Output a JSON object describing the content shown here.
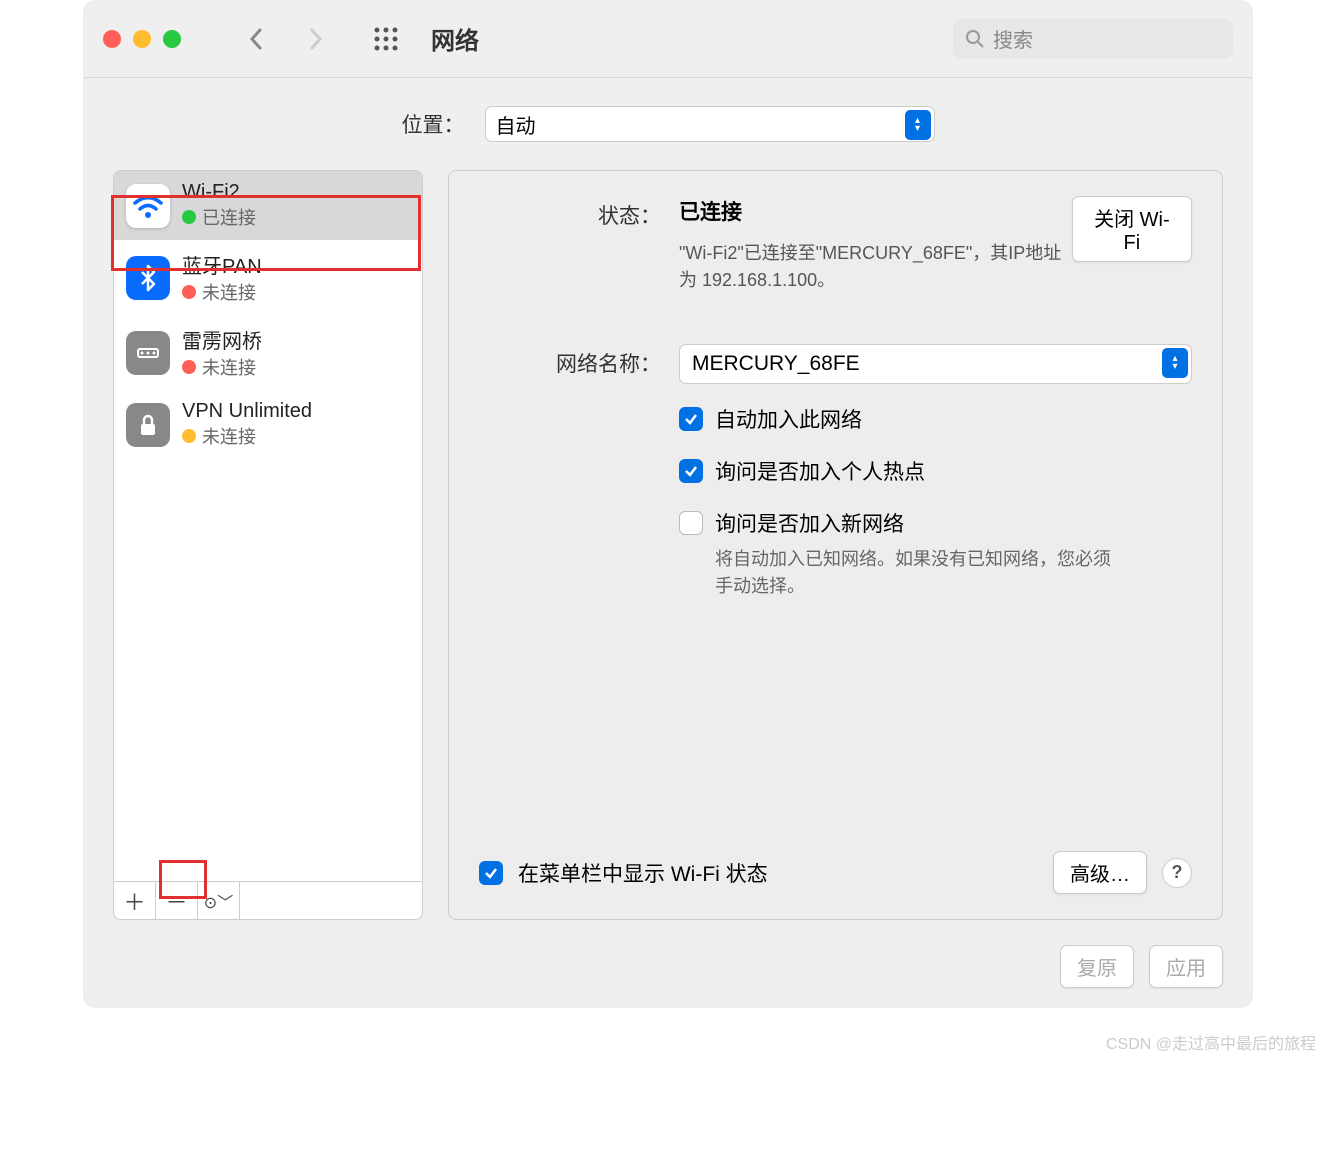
{
  "titlebar": {
    "title": "网络",
    "search_placeholder": "搜索"
  },
  "location": {
    "label": "位置：",
    "value": "自动"
  },
  "sidebar": {
    "items": [
      {
        "name": "Wi-Fi2",
        "status": "已连接",
        "dot": "green",
        "icon": "wifi"
      },
      {
        "name": "蓝牙PAN",
        "status": "未连接",
        "dot": "red",
        "icon": "bluetooth"
      },
      {
        "name": "雷雳网桥",
        "status": "未连接",
        "dot": "red",
        "icon": "thunderbolt"
      },
      {
        "name": "VPN Unlimited",
        "status": "未连接",
        "dot": "yellow",
        "icon": "vpn"
      }
    ]
  },
  "detail": {
    "status_label": "状态：",
    "status_value": "已连接",
    "turn_off_label": "关闭 Wi-Fi",
    "status_desc": "\"Wi-Fi2\"已连接至\"MERCURY_68FE\"，其IP地址为 192.168.1.100。",
    "network_name_label": "网络名称：",
    "network_name_value": "MERCURY_68FE",
    "auto_join_label": "自动加入此网络",
    "ask_hotspot_label": "询问是否加入个人热点",
    "ask_new_label": "询问是否加入新网络",
    "ask_new_help": "将自动加入已知网络。如果没有已知网络，您必须手动选择。",
    "show_menubar_label": "在菜单栏中显示 Wi-Fi 状态",
    "advanced_label": "高级…"
  },
  "buttons": {
    "revert": "复原",
    "apply": "应用"
  },
  "watermark": "CSDN @走过高中最后的旅程"
}
